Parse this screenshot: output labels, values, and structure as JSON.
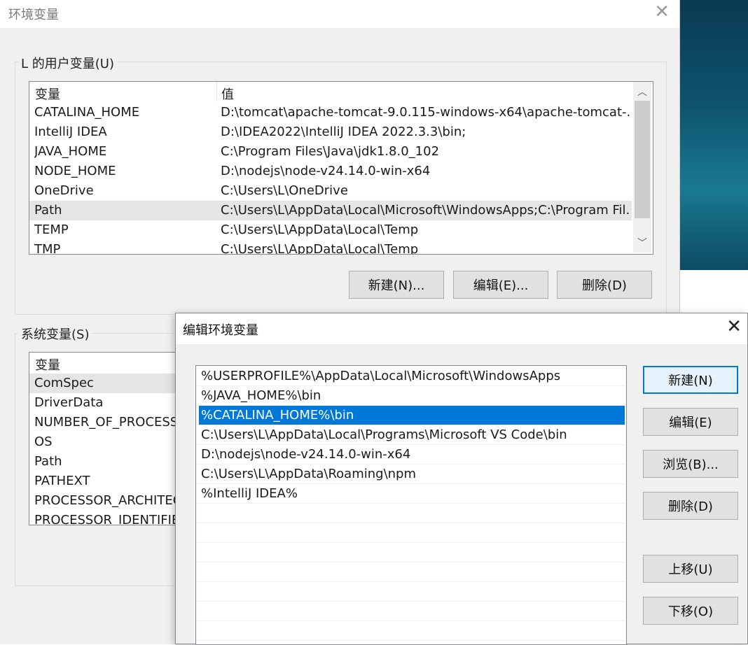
{
  "main_window": {
    "title": "环境变量",
    "user_group_label": "L 的用户变量(U)",
    "system_group_label": "系统变量(S)",
    "user_vars": {
      "col_name": "变量",
      "col_value": "值",
      "rows": [
        {
          "name": "CATALINA_HOME",
          "value": "D:\\tomcat\\apache-tomcat-9.0.115-windows-x64\\apache-tomcat-..."
        },
        {
          "name": "IntelliJ IDEA",
          "value": "D:\\IDEA2022\\IntelliJ IDEA 2022.3.3\\bin;"
        },
        {
          "name": "JAVA_HOME",
          "value": "C:\\Program Files\\Java\\jdk1.8.0_102"
        },
        {
          "name": "NODE_HOME",
          "value": "D:\\nodejs\\node-v24.14.0-win-x64"
        },
        {
          "name": "OneDrive",
          "value": "C:\\Users\\L\\OneDrive"
        },
        {
          "name": "Path",
          "value": "C:\\Users\\L\\AppData\\Local\\Microsoft\\WindowsApps;C:\\Program Fil..."
        },
        {
          "name": "TEMP",
          "value": "C:\\Users\\L\\AppData\\Local\\Temp"
        },
        {
          "name": "TMP",
          "value": "C:\\Users\\L\\AppData\\Local\\Temp"
        }
      ]
    },
    "user_buttons": {
      "new": "新建(N)...",
      "edit": "编辑(E)...",
      "delete": "删除(D)"
    },
    "system_vars": {
      "col_name": "变量",
      "rows": [
        {
          "name": "ComSpec"
        },
        {
          "name": "DriverData"
        },
        {
          "name": "NUMBER_OF_PROCESSORS"
        },
        {
          "name": "OS"
        },
        {
          "name": "Path"
        },
        {
          "name": "PATHEXT"
        },
        {
          "name": "PROCESSOR_ARCHITECTURE"
        },
        {
          "name": "PROCESSOR_IDENTIFIER"
        }
      ]
    }
  },
  "edit_dialog": {
    "title": "编辑环境变量",
    "paths": [
      "%USERPROFILE%\\AppData\\Local\\Microsoft\\WindowsApps",
      "%JAVA_HOME%\\bin",
      "%CATALINA_HOME%\\bin",
      "C:\\Users\\L\\AppData\\Local\\Programs\\Microsoft VS Code\\bin",
      "D:\\nodejs\\node-v24.14.0-win-x64",
      "C:\\Users\\L\\AppData\\Roaming\\npm",
      "%IntelliJ IDEA%"
    ],
    "selected_index": 2,
    "buttons": {
      "new": "新建(N)",
      "edit": "编辑(E)",
      "browse": "浏览(B)...",
      "delete": "删除(D)",
      "move_up": "上移(U)",
      "move_down": "下移(O)"
    }
  },
  "colors": {
    "selection": "#0078d7",
    "wallpaper": "#0e5470"
  }
}
